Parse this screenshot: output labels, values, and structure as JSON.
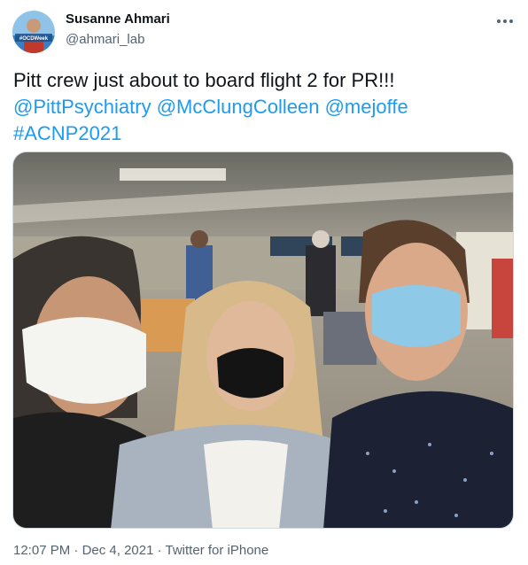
{
  "author": {
    "display_name": "Susanne Ahmari",
    "handle": "@ahmari_lab",
    "avatar_icon": "profile-photo",
    "avatar_badge_text": "#OCDWeek"
  },
  "menu": {
    "icon": "more-horizontal-icon"
  },
  "tweet": {
    "line1": "Pitt crew just about to board flight 2 for PR!!!",
    "mentions": [
      "@PittPsychiatry",
      "@McClungColleen",
      "@mejoffe"
    ],
    "hashtag": "#ACNP2021"
  },
  "media": {
    "description_icon": "airport-selfie-photo"
  },
  "meta": {
    "time": "12:07 PM",
    "separator": " · ",
    "date": "Dec 4, 2021",
    "source": "Twitter for iPhone"
  },
  "colors": {
    "link": "#1d9bf0",
    "text": "#0f1419",
    "secondary": "#536471"
  }
}
